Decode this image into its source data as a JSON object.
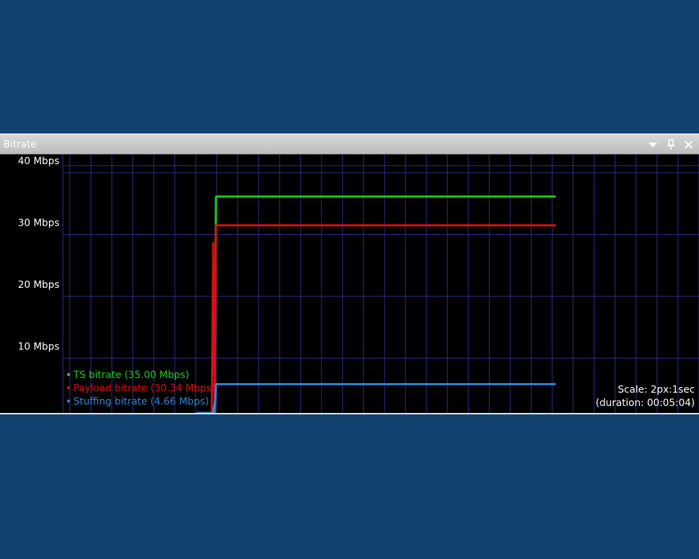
{
  "window": {
    "title": "Bitrate",
    "buttons": [
      {
        "name": "dropdown-button",
        "icon": "chevron-down-icon"
      },
      {
        "name": "pin-button",
        "icon": "pin-icon"
      },
      {
        "name": "close-button",
        "icon": "close-icon"
      }
    ]
  },
  "colors": {
    "background": "#114270",
    "plot_bg": "#000000",
    "grid": "#2f2f8f",
    "ts": "#18d018",
    "payload": "#d81010",
    "stuffing": "#2f86d8",
    "text": "#ffffff"
  },
  "overlay": {
    "scale": "Scale: 2px:1sec",
    "duration": "(duration: 00:05:04)"
  },
  "chart_data": {
    "type": "line",
    "y_tick_labels": [
      "40 Mbps",
      "30 Mbps",
      "20 Mbps",
      "10 Mbps"
    ],
    "y_ticks": [
      40,
      30,
      20,
      10
    ],
    "ylim": [
      0,
      40
    ],
    "x_unit": "seconds",
    "xlim": [
      0,
      350
    ],
    "grid": true,
    "legend_position": "bottom-left",
    "series": [
      {
        "name": "TS bitrate (35.00 Mbps)",
        "color": "#18d018",
        "x": [
          105,
          106,
          107,
          350
        ],
        "y": [
          0,
          1.5,
          35,
          35
        ]
      },
      {
        "name": "Payload bitrate (30.34 Mbps)",
        "color": "#d81010",
        "x": [
          104,
          105,
          106,
          107,
          350
        ],
        "y": [
          0,
          27.5,
          2,
          30.34,
          30.34
        ]
      },
      {
        "name": "Stuffing bitrate (4.66 Mbps)",
        "color": "#2f86d8",
        "x": [
          93,
          106,
          107,
          350
        ],
        "y": [
          0,
          0,
          4.66,
          4.66
        ]
      }
    ]
  }
}
